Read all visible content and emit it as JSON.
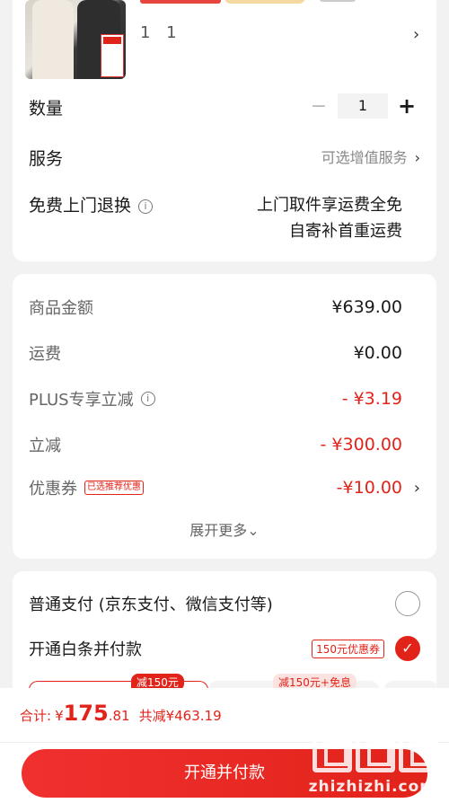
{
  "product": {
    "spec": "1 1",
    "chevron": "›"
  },
  "quantity": {
    "label": "数量",
    "minus": "−",
    "value": "1",
    "plus": "+"
  },
  "service": {
    "label": "服务",
    "value": "可选增值服务",
    "chevron": "›"
  },
  "free_return": {
    "label": "免费上门退换",
    "info_icon": "i",
    "line1": "上门取件享运费全免",
    "line2": "自寄补首重运费"
  },
  "summary": {
    "goods_label": "商品金额",
    "goods_value": "¥639.00",
    "shipping_label": "运费",
    "shipping_value": "¥0.00",
    "plus_label": "PLUS专享立减",
    "plus_info": "i",
    "plus_value": "- ¥3.19",
    "discount_label": "立减",
    "discount_value": "- ¥300.00",
    "coupon_label": "优惠券",
    "coupon_tag": "已选推荐优惠",
    "coupon_value": "-¥10.00",
    "coupon_chevron": "›",
    "expand": "展开更多⌄"
  },
  "payment": {
    "normal_label": "普通支付 (京东支付、微信支付等)",
    "baitiao_label": "开通白条并付款",
    "baitiao_badge": "150元优惠券",
    "baitiao_check": "✓",
    "plan_tag1": "减150元",
    "plan_tag2": "减150元+免息"
  },
  "bottom": {
    "total_label": "合计:",
    "total_yen": "¥",
    "total_int": "175",
    "total_dec": ".81",
    "saved": "共减¥463.19",
    "cta": "开通并付款"
  },
  "watermark": {
    "site": "zhizhizhi.com"
  },
  "colors": {
    "accent": "#e2231a",
    "background": "#f2f2f2"
  }
}
